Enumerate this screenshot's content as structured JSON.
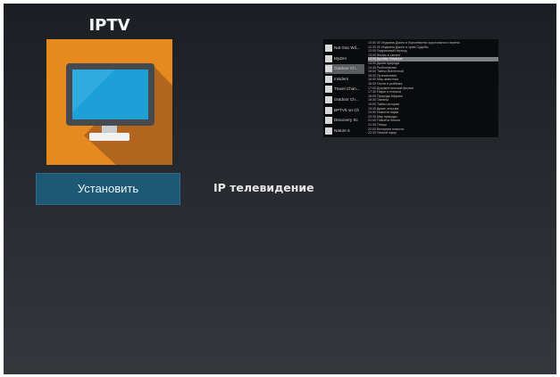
{
  "app": {
    "title": "IPTV",
    "install_label": "Установить",
    "description": "IP телевидение"
  },
  "colors": {
    "icon_background": "#e6891f",
    "button_background": "#1d5976"
  },
  "icon": "tv-monitor-icon",
  "preview": {
    "channels": [
      {
        "name": "Nat Geo Wil..."
      },
      {
        "name": "MyZen"
      },
      {
        "name": "Outdoor Ch..."
      },
      {
        "name": "Insiders"
      },
      {
        "name": "Travel Chan..."
      },
      {
        "name": "Outdoor Ch..."
      },
      {
        "name": "BPTV5 on Ch"
      },
      {
        "name": "Discovery Sc"
      },
      {
        "name": "Nature 5"
      }
    ],
    "epg": [
      {
        "time": "12:00 00",
        "title": "Индиана Джонс и Королевство хрустального черепа"
      },
      {
        "time": "12:30 00",
        "title": "Индиана Джонс и храм Судьбы"
      },
      {
        "time": "12:00",
        "title": "Ледниковый период"
      },
      {
        "time": "13:00",
        "title": "Жизнь в океане"
      },
      {
        "time": "13:30",
        "title": "Джеймс Кэмерон"
      },
      {
        "time": "14:00",
        "title": "Дикая природа"
      },
      {
        "time": "14:30",
        "title": "Рыболовство"
      },
      {
        "time": "15:00",
        "title": "Тайны Вселенной"
      },
      {
        "time": "15:30",
        "title": "Путешествия"
      },
      {
        "time": "16:00",
        "title": "Мир животных"
      },
      {
        "time": "16:30",
        "title": "Охота и рыбалка"
      },
      {
        "time": "17:00",
        "title": "Документальный фильм"
      },
      {
        "time": "17:30",
        "title": "Науки и техника"
      },
      {
        "time": "18:00",
        "title": "Природа Африки"
      },
      {
        "time": "18:30",
        "title": "Океаны"
      },
      {
        "time": "19:00",
        "title": "Тайны истории"
      },
      {
        "time": "19:30",
        "title": "Дикие острова"
      },
      {
        "time": "20:00",
        "title": "Новости науки"
      },
      {
        "time": "20:30",
        "title": "Мир природы"
      },
      {
        "time": "21:00",
        "title": "Планета Земля"
      },
      {
        "time": "21:30",
        "title": "Птицы"
      },
      {
        "time": "22:00",
        "title": "Вечерние новости"
      },
      {
        "time": "22:30",
        "title": "Ночной эфир"
      }
    ]
  }
}
